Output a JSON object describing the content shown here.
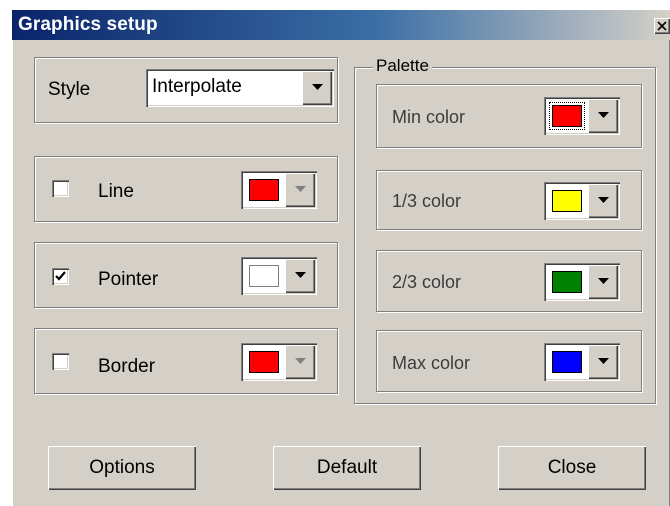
{
  "window": {
    "title": "Graphics setup"
  },
  "style": {
    "label": "Style",
    "value": "Interpolate"
  },
  "line": {
    "label": "Line",
    "checked": false,
    "color": "#ff0000",
    "enabled": false
  },
  "pointer": {
    "label": "Pointer",
    "checked": true,
    "color": "#ffffff",
    "enabled": true
  },
  "border": {
    "label": "Border",
    "checked": false,
    "color": "#ff0000",
    "enabled": false
  },
  "palette": {
    "title": "Palette",
    "min": {
      "label": "Min color",
      "color": "#ff0000"
    },
    "third1": {
      "label": "1/3 color",
      "color": "#ffff00"
    },
    "third2": {
      "label": "2/3 color",
      "color": "#008000"
    },
    "max": {
      "label": "Max color",
      "color": "#0000ff"
    }
  },
  "buttons": {
    "options": "Options",
    "default": "Default",
    "close": "Close"
  }
}
